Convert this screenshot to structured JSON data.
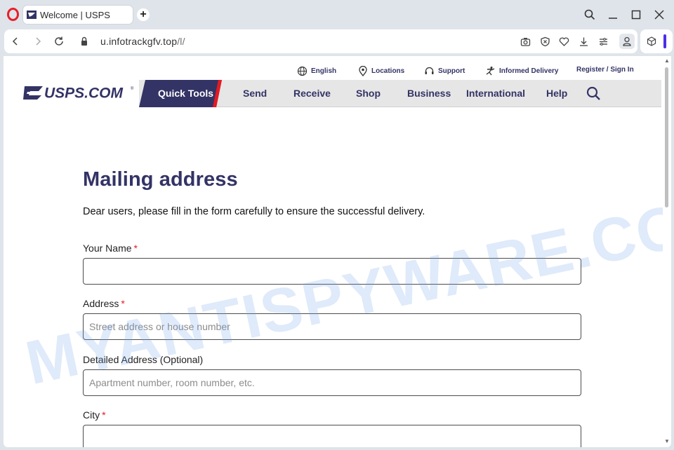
{
  "browser": {
    "tab_title": "Welcome | USPS",
    "new_tab_label": "+",
    "url_host": "u.infotrackgfv.top",
    "url_path": "/l/"
  },
  "utility_nav": {
    "english": "English",
    "locations": "Locations",
    "support": "Support",
    "informed_delivery": "Informed Delivery",
    "register": "Register / Sign In"
  },
  "logo_text": "USPS.COM",
  "main_nav": {
    "quick_tools": "Quick Tools",
    "send": "Send",
    "receive": "Receive",
    "shop": "Shop",
    "business": "Business",
    "international": "International",
    "help": "Help"
  },
  "watermark": "MYANTISPYWARE.COM",
  "form": {
    "title": "Mailing address",
    "intro": "Dear users, please fill in the form carefully to ensure the successful delivery.",
    "required_mark": "*",
    "name_label": "Your Name",
    "name_value": "",
    "address_label": "Address",
    "address_placeholder": "Street address or house number",
    "detail_label": "Detailed Address (Optional)",
    "detail_placeholder": "Apartment number, room number, etc.",
    "city_label": "City",
    "city_value": ""
  },
  "colors": {
    "usps_blue": "#333366",
    "usps_red": "#e71921",
    "nav_gray": "#e6e6e6",
    "browser_accent": "#4b2ee8",
    "opera_red": "#e8202a"
  }
}
